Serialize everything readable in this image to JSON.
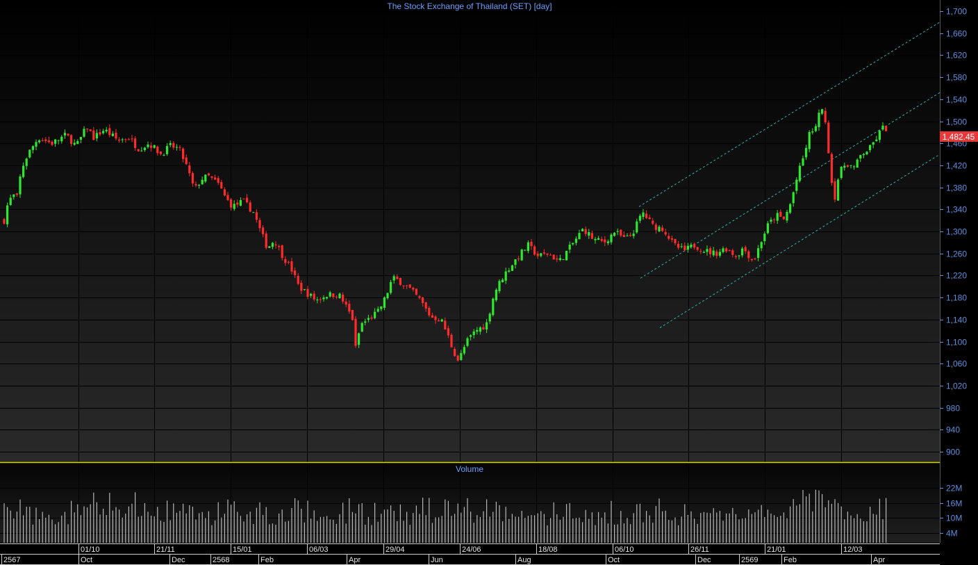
{
  "price_panel": {
    "title": "The Stock Exchange of Thailand (SET) [day]",
    "last_price_label": "1,482.45",
    "y_tick_labels": [
      "1,700",
      "1,660",
      "1,620",
      "1,580",
      "1,540",
      "1,500",
      "1,460",
      "1,420",
      "1,380",
      "1,340",
      "1,300",
      "1,260",
      "1,220",
      "1,180",
      "1,140",
      "1,100",
      "1,060",
      "1,020",
      "980",
      "940",
      "900"
    ]
  },
  "volume_panel": {
    "title": "Volume",
    "y_tick_labels": [
      "22M",
      "16M",
      "10M",
      "4M"
    ]
  },
  "date_axis": {
    "top_row": [
      "01/10",
      "21/11",
      "15/01",
      "06/03",
      "29/04",
      "24/06",
      "18/08",
      "06/10",
      "26/11",
      "21/01",
      "12/03"
    ],
    "bottom_row": [
      "2567",
      "Oct",
      "Dec",
      "2568",
      "Feb",
      "Apr",
      "Jun",
      "Aug",
      "Oct",
      "Dec",
      "2569",
      "Feb",
      "Apr"
    ]
  },
  "colors": {
    "up": "#2ee82e",
    "down": "#ff2a2a",
    "axis_text": "#5e8fe0",
    "title": "#6aa0ff",
    "last_price_bg": "#e8393a",
    "channel": "#29b3b3",
    "volume_bar": "#b8b8b8",
    "divider": "#d8d800"
  },
  "chart_data": {
    "type": "candlestick",
    "title": "The Stock Exchange of Thailand (SET) [day]",
    "ylim": [
      880,
      1710
    ],
    "close_path": [
      {
        "t": 0,
        "v": 1290
      },
      {
        "t": 6,
        "v": 1320
      },
      {
        "t": 12,
        "v": 1355
      },
      {
        "t": 20,
        "v": 1365
      },
      {
        "t": 26,
        "v": 1360
      },
      {
        "t": 30,
        "v": 1410
      },
      {
        "t": 40,
        "v": 1440
      },
      {
        "t": 55,
        "v": 1470
      },
      {
        "t": 75,
        "v": 1460
      },
      {
        "t": 95,
        "v": 1475
      },
      {
        "t": 110,
        "v": 1455
      },
      {
        "t": 125,
        "v": 1490
      },
      {
        "t": 135,
        "v": 1470
      },
      {
        "t": 150,
        "v": 1485
      },
      {
        "t": 170,
        "v": 1465
      },
      {
        "t": 185,
        "v": 1470
      },
      {
        "t": 200,
        "v": 1450
      },
      {
        "t": 215,
        "v": 1460
      },
      {
        "t": 232,
        "v": 1440
      },
      {
        "t": 245,
        "v": 1455
      },
      {
        "t": 258,
        "v": 1450
      },
      {
        "t": 268,
        "v": 1420
      },
      {
        "t": 280,
        "v": 1375
      },
      {
        "t": 290,
        "v": 1395
      },
      {
        "t": 300,
        "v": 1400
      },
      {
        "t": 315,
        "v": 1385
      },
      {
        "t": 325,
        "v": 1360
      },
      {
        "t": 335,
        "v": 1345
      },
      {
        "t": 350,
        "v": 1355
      },
      {
        "t": 365,
        "v": 1335
      },
      {
        "t": 375,
        "v": 1300
      },
      {
        "t": 385,
        "v": 1270
      },
      {
        "t": 395,
        "v": 1285
      },
      {
        "t": 405,
        "v": 1260
      },
      {
        "t": 420,
        "v": 1230
      },
      {
        "t": 430,
        "v": 1200
      },
      {
        "t": 440,
        "v": 1190
      },
      {
        "t": 455,
        "v": 1175
      },
      {
        "t": 470,
        "v": 1185
      },
      {
        "t": 488,
        "v": 1185
      },
      {
        "t": 500,
        "v": 1160
      },
      {
        "t": 508,
        "v": 1140
      },
      {
        "t": 513,
        "v": 1075
      },
      {
        "t": 518,
        "v": 1130
      },
      {
        "t": 530,
        "v": 1140
      },
      {
        "t": 545,
        "v": 1155
      },
      {
        "t": 555,
        "v": 1180
      },
      {
        "t": 565,
        "v": 1215
      },
      {
        "t": 575,
        "v": 1210
      },
      {
        "t": 590,
        "v": 1195
      },
      {
        "t": 605,
        "v": 1175
      },
      {
        "t": 620,
        "v": 1145
      },
      {
        "t": 635,
        "v": 1140
      },
      {
        "t": 645,
        "v": 1110
      },
      {
        "t": 652,
        "v": 1085
      },
      {
        "t": 660,
        "v": 1065
      },
      {
        "t": 672,
        "v": 1100
      },
      {
        "t": 685,
        "v": 1120
      },
      {
        "t": 700,
        "v": 1130
      },
      {
        "t": 712,
        "v": 1190
      },
      {
        "t": 725,
        "v": 1220
      },
      {
        "t": 740,
        "v": 1245
      },
      {
        "t": 760,
        "v": 1275
      },
      {
        "t": 775,
        "v": 1255
      },
      {
        "t": 790,
        "v": 1260
      },
      {
        "t": 805,
        "v": 1245
      },
      {
        "t": 820,
        "v": 1270
      },
      {
        "t": 840,
        "v": 1305
      },
      {
        "t": 855,
        "v": 1285
      },
      {
        "t": 870,
        "v": 1280
      },
      {
        "t": 885,
        "v": 1300
      },
      {
        "t": 900,
        "v": 1285
      },
      {
        "t": 910,
        "v": 1295
      },
      {
        "t": 925,
        "v": 1335
      },
      {
        "t": 940,
        "v": 1310
      },
      {
        "t": 955,
        "v": 1305
      },
      {
        "t": 970,
        "v": 1275
      },
      {
        "t": 985,
        "v": 1265
      },
      {
        "t": 1000,
        "v": 1275
      },
      {
        "t": 1015,
        "v": 1265
      },
      {
        "t": 1030,
        "v": 1260
      },
      {
        "t": 1045,
        "v": 1270
      },
      {
        "t": 1060,
        "v": 1255
      },
      {
        "t": 1070,
        "v": 1270
      },
      {
        "t": 1085,
        "v": 1245
      },
      {
        "t": 1095,
        "v": 1280
      },
      {
        "t": 1105,
        "v": 1310
      },
      {
        "t": 1118,
        "v": 1330
      },
      {
        "t": 1128,
        "v": 1320
      },
      {
        "t": 1138,
        "v": 1350
      },
      {
        "t": 1148,
        "v": 1400
      },
      {
        "t": 1158,
        "v": 1440
      },
      {
        "t": 1166,
        "v": 1480
      },
      {
        "t": 1175,
        "v": 1490
      },
      {
        "t": 1183,
        "v": 1530
      },
      {
        "t": 1190,
        "v": 1480
      },
      {
        "t": 1196,
        "v": 1410
      },
      {
        "t": 1200,
        "v": 1350
      },
      {
        "t": 1208,
        "v": 1405
      },
      {
        "t": 1218,
        "v": 1425
      },
      {
        "t": 1230,
        "v": 1415
      },
      {
        "t": 1240,
        "v": 1440
      },
      {
        "t": 1252,
        "v": 1450
      },
      {
        "t": 1262,
        "v": 1470
      },
      {
        "t": 1272,
        "v": 1490
      },
      {
        "t": 1280,
        "v": 1482
      }
    ],
    "volume_range_millions": [
      0,
      28
    ],
    "trend_channel": [
      {
        "name": "upper",
        "from": [
          920,
          1345
        ],
        "to": [
          1353,
          1680
        ]
      },
      {
        "name": "middle",
        "from": [
          922,
          1215
        ],
        "to": [
          1353,
          1552
        ]
      },
      {
        "name": "lower",
        "from": [
          950,
          1125
        ],
        "to": [
          1353,
          1440
        ]
      }
    ]
  }
}
